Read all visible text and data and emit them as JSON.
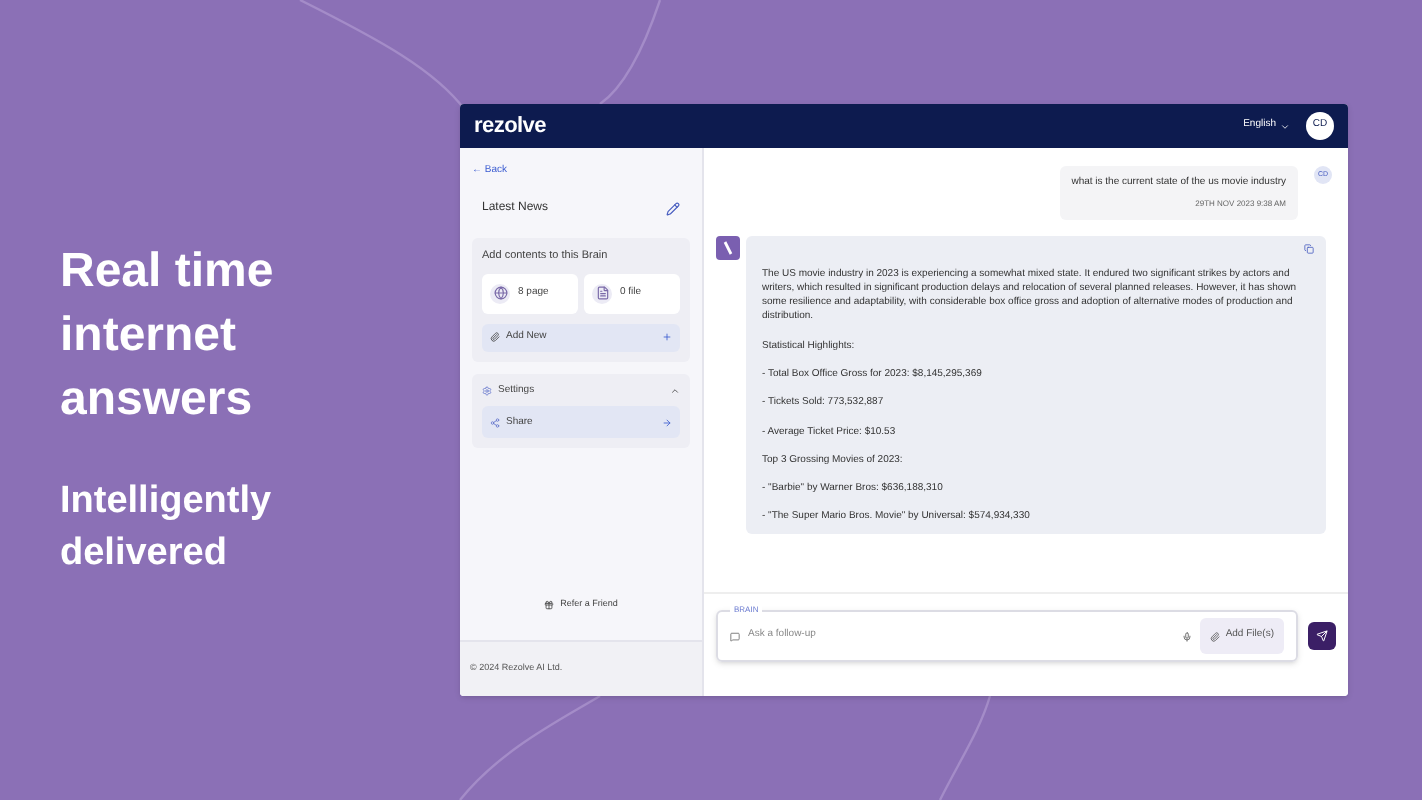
{
  "hero": {
    "headline": "Real time internet answers",
    "tagline": "Intelligently delivered"
  },
  "header": {
    "logo": "rezolve",
    "language": "English",
    "avatar": "CD"
  },
  "sidebar": {
    "back": "← Back",
    "brain_name": "Latest News",
    "contents_title": "Add contents to this Brain",
    "sources": [
      {
        "kind": "globe",
        "label": "8 page"
      },
      {
        "kind": "file",
        "label": "0 file"
      }
    ],
    "add_new": "Add New",
    "settings": {
      "label": "Settings",
      "expanded": true
    },
    "share": "Share",
    "refer": "Refer a Friend",
    "footer": "© 2024 Rezolve AI Ltd."
  },
  "chat": {
    "question": {
      "text": "what is the current state of the us movie industry",
      "time": "29TH NOV 2023 9:38 AM",
      "avatar": "CD"
    },
    "answer": [
      "The US movie industry in 2023 is experiencing a somewhat mixed state. It endured two significant strikes by actors and writers, which resulted in significant production delays and relocation of several planned releases. However, it has shown some resilience and adaptability, with considerable box office gross and adoption of alternative modes of production and distribution.",
      "Statistical Highlights:",
      "- Total Box Office Gross for 2023: $8,145,295,369",
      "- Tickets Sold: 773,532,887",
      "- Average Ticket Price: $10.53",
      "Top 3 Grossing Movies of 2023:",
      "- \"Barbie\" by Warner Bros: $636,188,310",
      "- \"The Super Mario Bros. Movie\" by Universal: $574,934,330"
    ]
  },
  "composer": {
    "label": "BRAIN",
    "placeholder": "Ask a follow-up",
    "add_files": "Add File(s)"
  }
}
